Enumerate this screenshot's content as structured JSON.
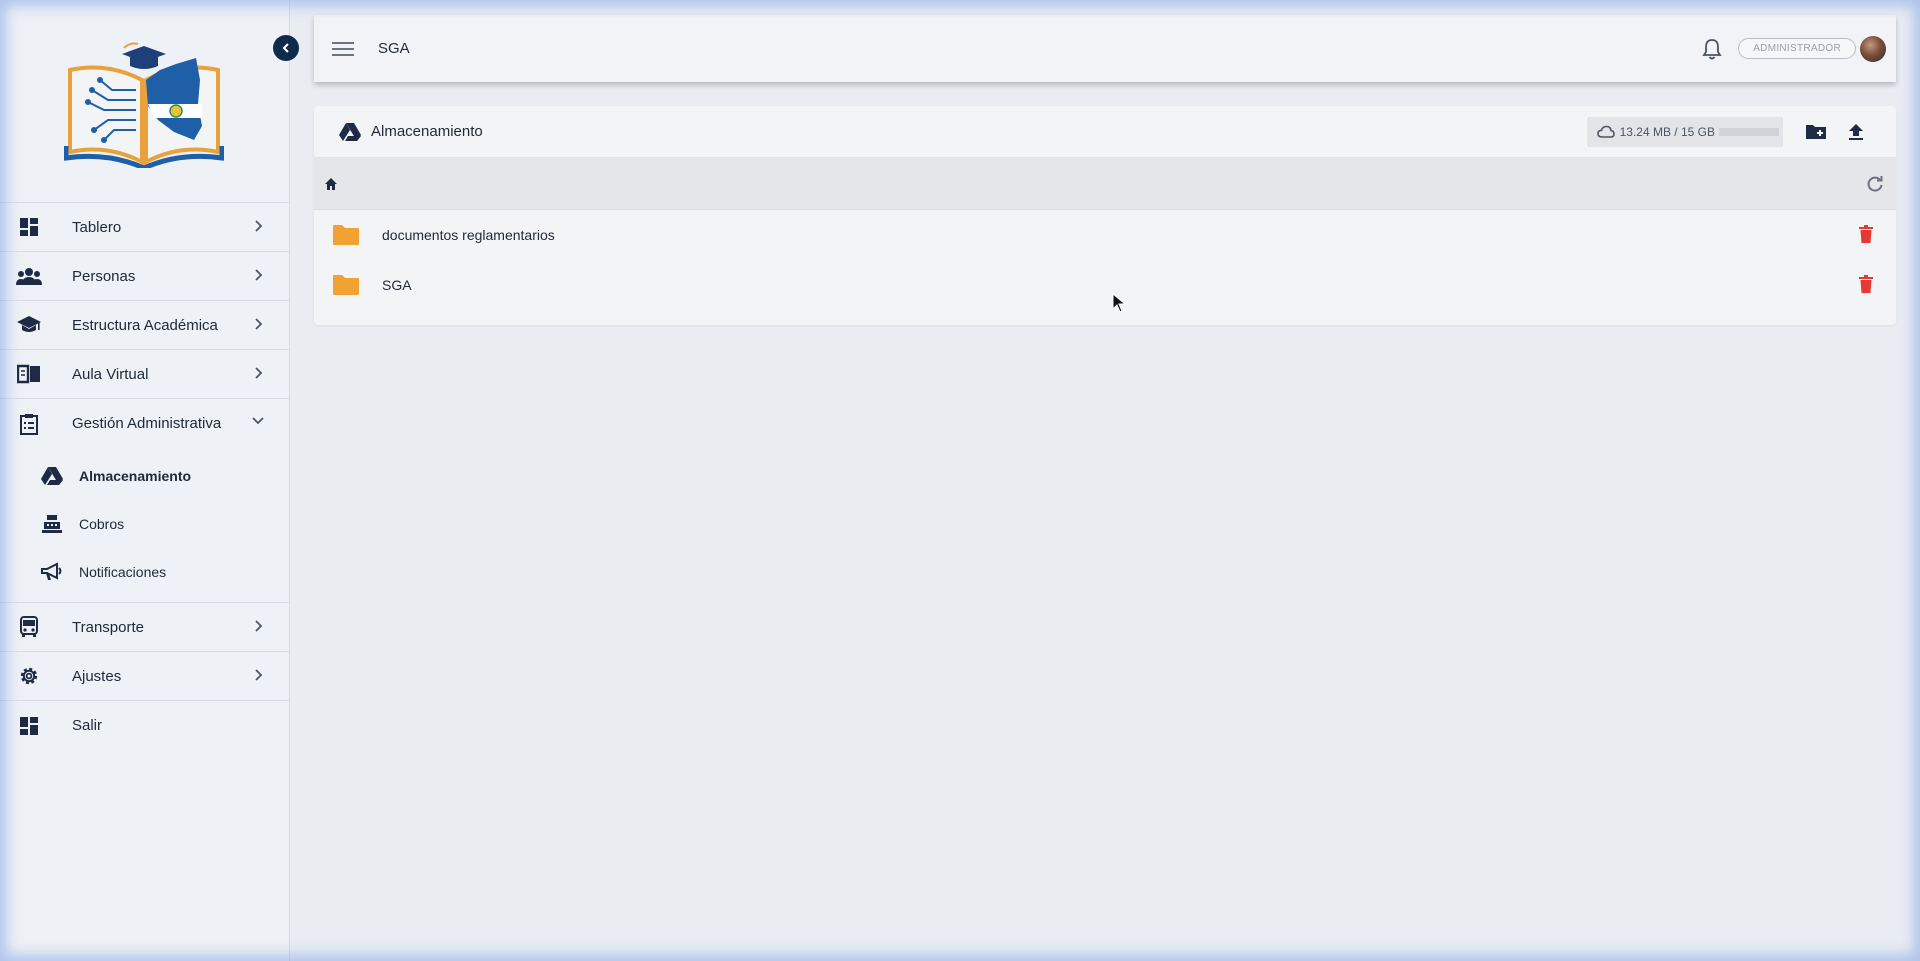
{
  "sidebar": {
    "items": [
      {
        "label": "Tablero",
        "icon": "dashboard-icon"
      },
      {
        "label": "Personas",
        "icon": "people-icon"
      },
      {
        "label": "Estructura Académica",
        "icon": "school-icon"
      },
      {
        "label": "Aula Virtual",
        "icon": "book-icon"
      },
      {
        "label": "Gestión Administrativa",
        "icon": "clipboard-icon"
      }
    ],
    "subitems": [
      {
        "label": "Almacenamiento",
        "icon": "drive-icon"
      },
      {
        "label": "Cobros",
        "icon": "cash-register-icon"
      },
      {
        "label": "Notificaciones",
        "icon": "megaphone-icon"
      }
    ],
    "bottom_items": [
      {
        "label": "Transporte",
        "icon": "bus-icon"
      },
      {
        "label": "Ajustes",
        "icon": "gear-icon"
      },
      {
        "label": "Salir",
        "icon": "dashboard-icon"
      }
    ]
  },
  "topbar": {
    "title": "SGA",
    "role": "ADMINISTRADOR"
  },
  "storage": {
    "title": "Almacenamiento",
    "quota_text": "13.24 MB / 15 GB",
    "quota_fraction": 0.001
  },
  "files": [
    {
      "name": "documentos reglamentarios"
    },
    {
      "name": "SGA"
    }
  ],
  "colors": {
    "folder": "#f2a233",
    "delete": "#e53935",
    "accent_dark": "#0f2a4a"
  }
}
